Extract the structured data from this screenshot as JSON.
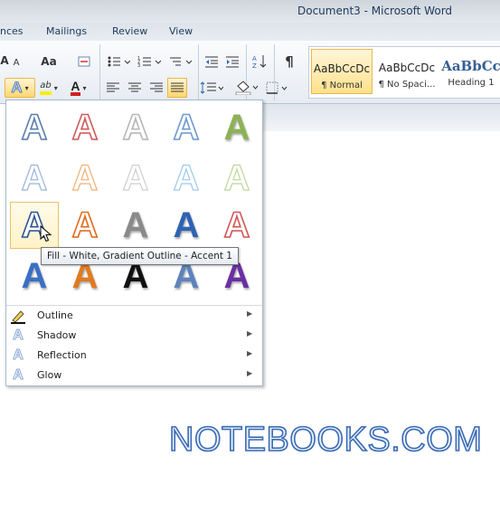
{
  "window": {
    "title": "Document3  -  Microsoft Word"
  },
  "tabs": [
    "nces",
    "Mailings",
    "Review",
    "View"
  ],
  "toolbar": {
    "font_grow": "A",
    "font_shrink": "A",
    "change_case": "Aa",
    "text_effect_button": "A",
    "highlight": "ab",
    "font_color": "A",
    "show_paragraph": "¶"
  },
  "styles_gallery": {
    "items": [
      {
        "sample": "AaBbCcDc",
        "name": "¶ Normal",
        "selected": true
      },
      {
        "sample": "AaBbCcDc",
        "name": "¶ No Spaci...",
        "selected": false
      },
      {
        "sample": "AaBbCc",
        "name": "Heading 1",
        "selected": false
      }
    ]
  },
  "text_effects": {
    "glyph": "A",
    "rows": [
      {
        "cells": [
          {
            "style": "outline",
            "color": "#5b7fb0"
          },
          {
            "style": "outline",
            "color": "#d15a5a"
          },
          {
            "style": "outline",
            "color": "#b8b8b8"
          },
          {
            "style": "outline",
            "color": "#6f9ad1"
          },
          {
            "style": "fill",
            "color": "#8db255"
          }
        ]
      },
      {
        "cells": [
          {
            "style": "soft",
            "color": "#8aa8d4"
          },
          {
            "style": "soft",
            "color": "#f0a35c"
          },
          {
            "style": "soft",
            "color": "#c8c8c8"
          },
          {
            "style": "soft",
            "color": "#8dc1e8"
          },
          {
            "style": "soft",
            "color": "#b5cf8a"
          }
        ]
      },
      {
        "cells": [
          {
            "style": "outline",
            "color": "#2d5597"
          },
          {
            "style": "outline",
            "color": "#e26b1b"
          },
          {
            "style": "fill",
            "color": "#8a8a8a"
          },
          {
            "style": "fill",
            "color": "#2e63b3"
          },
          {
            "style": "outline",
            "color": "#d35656"
          }
        ]
      },
      {
        "cells": [
          {
            "style": "fill",
            "color": "#3a6fc4"
          },
          {
            "style": "fill",
            "color": "#e07a1f"
          },
          {
            "style": "fill",
            "color": "#111111"
          },
          {
            "style": "fill",
            "color": "#5d83bd"
          },
          {
            "style": "fill",
            "color": "#6b2fa3"
          }
        ]
      }
    ],
    "hovered": {
      "row": 2,
      "col": 0
    },
    "tooltip": "Fill - White, Gradient Outline - Accent 1",
    "menu": [
      {
        "label": "Outline",
        "icon": "pen-outline-icon"
      },
      {
        "label": "Shadow",
        "icon": "shadow-a-icon"
      },
      {
        "label": "Reflection",
        "icon": "reflection-a-icon"
      },
      {
        "label": "Glow",
        "icon": "glow-a-icon"
      }
    ]
  },
  "document": {
    "text": "NOTEBOOKS.COM"
  }
}
